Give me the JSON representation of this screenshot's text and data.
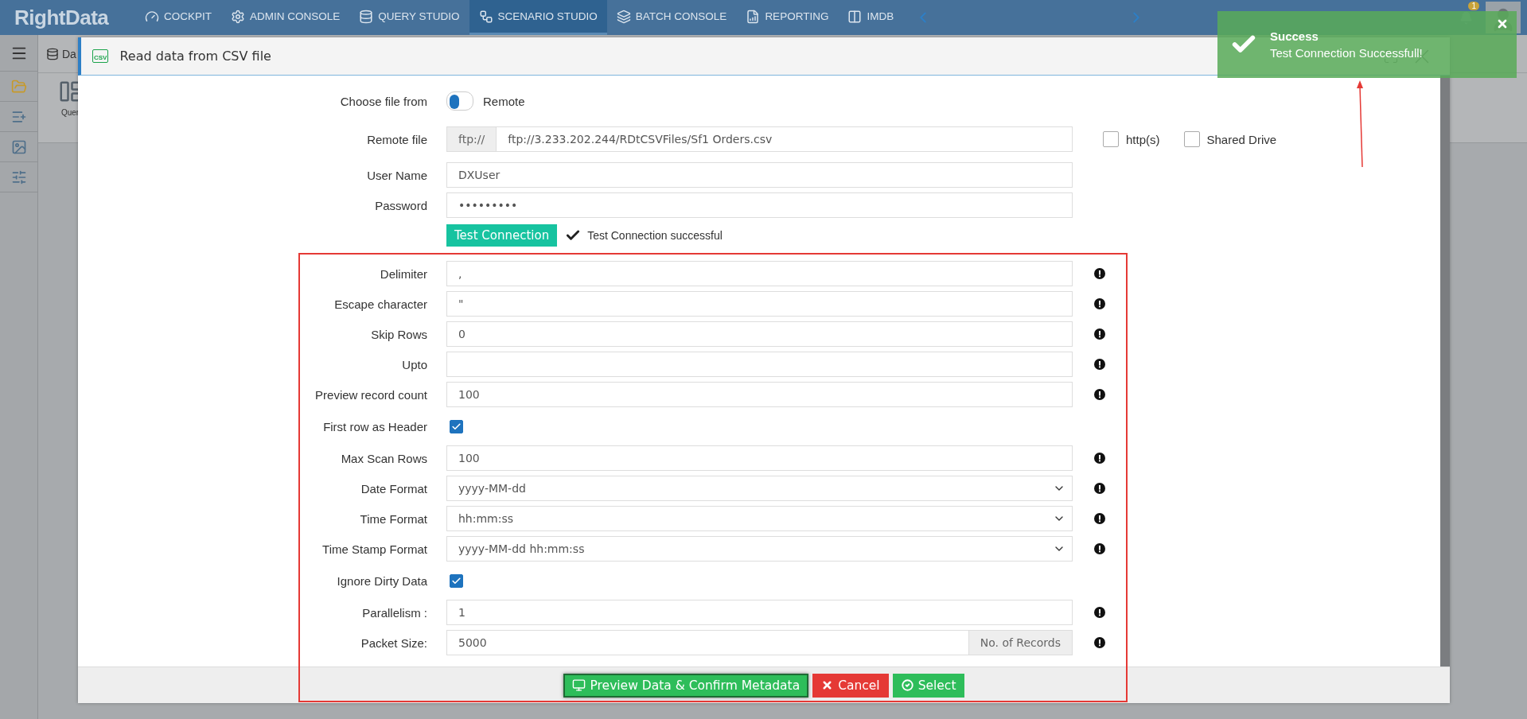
{
  "nav": {
    "logo": "RightData",
    "items": [
      {
        "label": "COCKPIT",
        "selected": false
      },
      {
        "label": "ADMIN CONSOLE",
        "selected": false
      },
      {
        "label": "QUERY STUDIO",
        "selected": false
      },
      {
        "label": "SCENARIO STUDIO",
        "selected": true
      },
      {
        "label": "BATCH CONSOLE",
        "selected": false
      },
      {
        "label": "REPORTING",
        "selected": false
      },
      {
        "label": "IMDB",
        "selected": false
      }
    ],
    "notification_count": "1"
  },
  "background": {
    "breadcrumb": "Da",
    "tool_label": "Quer"
  },
  "dialog": {
    "title": "Read data from CSV file",
    "icon_label": "CSV",
    "source": {
      "label": "Choose file from",
      "on": false,
      "value_label": "Remote"
    },
    "remote_file": {
      "label": "Remote file",
      "prefix": "ftp://",
      "value": "ftp://3.233.202.244/RDtCSVFiles/Sf1 Orders.csv"
    },
    "options": [
      {
        "label": "http(s)",
        "checked": false
      },
      {
        "label": "Shared Drive",
        "checked": false
      }
    ],
    "user_name": {
      "label": "User Name",
      "value": "DXUser"
    },
    "password": {
      "label": "Password",
      "value": "•••••••••"
    },
    "test_button": "Test Connection",
    "test_status": "Test Connection successful",
    "fields": [
      {
        "label": "Delimiter",
        "kind": "text",
        "value": ","
      },
      {
        "label": "Escape character",
        "kind": "text",
        "value": "\""
      },
      {
        "label": "Skip Rows",
        "kind": "text",
        "value": "0"
      },
      {
        "label": "Upto",
        "kind": "text"
      },
      {
        "label": "Preview record count",
        "kind": "text",
        "value": "100"
      },
      {
        "label": "First row as Header",
        "kind": "checkbox",
        "checked": true
      },
      {
        "label": "Max Scan Rows",
        "kind": "text",
        "value": "100"
      },
      {
        "label": "Date Format",
        "kind": "select",
        "value": "yyyy-MM-dd"
      },
      {
        "label": "Time Format",
        "kind": "select",
        "value": "hh:mm:ss"
      },
      {
        "label": "Time Stamp Format",
        "kind": "select",
        "value": "yyyy-MM-dd hh:mm:ss"
      },
      {
        "label": "Ignore Dirty Data",
        "kind": "checkbox",
        "checked": true
      },
      {
        "label": "Parallelism :",
        "kind": "text",
        "value": "1"
      },
      {
        "label": "Packet Size:",
        "kind": "suffix",
        "value": "5000",
        "suffix": "No. of Records"
      }
    ],
    "buttons": [
      {
        "label": "Preview Data & Confirm Metadata",
        "kind": "preview",
        "focused": true
      },
      {
        "label": "Cancel",
        "kind": "cancel",
        "focused": false
      },
      {
        "label": "Select",
        "kind": "select",
        "focused": false
      }
    ]
  },
  "toast": {
    "title": "Success",
    "message": "Test Connection Successfull!"
  }
}
